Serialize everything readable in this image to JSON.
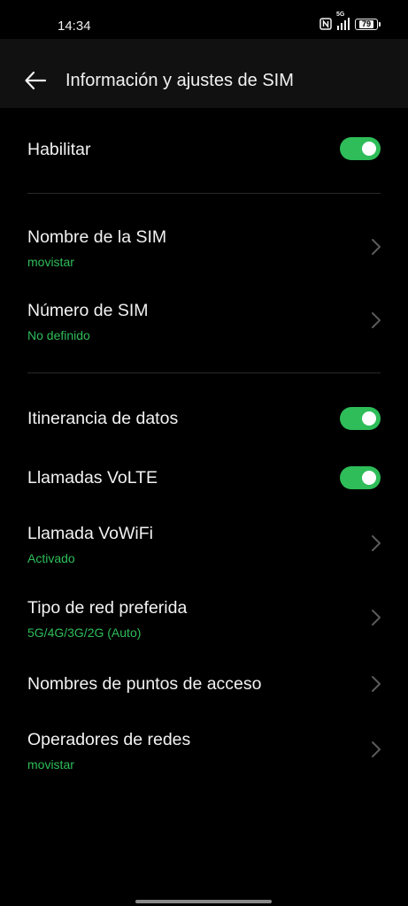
{
  "status_bar": {
    "time": "14:34",
    "network": "5G",
    "battery": "79",
    "icons": [
      "nfc-icon",
      "signal-icon",
      "battery-icon"
    ]
  },
  "header": {
    "title": "Información y ajustes de SIM",
    "back_icon": "arrow-left-icon"
  },
  "settings": {
    "enable": {
      "label": "Habilitar",
      "toggle": true
    },
    "sim_name": {
      "label": "Nombre de la SIM",
      "value": "movistar"
    },
    "sim_number": {
      "label": "Número de SIM",
      "value": "No definido"
    },
    "data_roaming": {
      "label": "Itinerancia de datos",
      "toggle": true
    },
    "volte": {
      "label": "Llamadas VoLTE",
      "toggle": true
    },
    "vowifi": {
      "label": "Llamada VoWiFi",
      "value": "Activado"
    },
    "network_type": {
      "label": "Tipo de red preferida",
      "value": "5G/4G/3G/2G (Auto)"
    },
    "apn": {
      "label": "Nombres de puntos de acceso"
    },
    "operators": {
      "label": "Operadores de redes",
      "value": "movistar"
    }
  },
  "colors": {
    "background": "#000000",
    "header_background": "#111111",
    "accent": "#2ebd59",
    "text": "#f2f2f2",
    "chevron": "#5a5a5a"
  }
}
